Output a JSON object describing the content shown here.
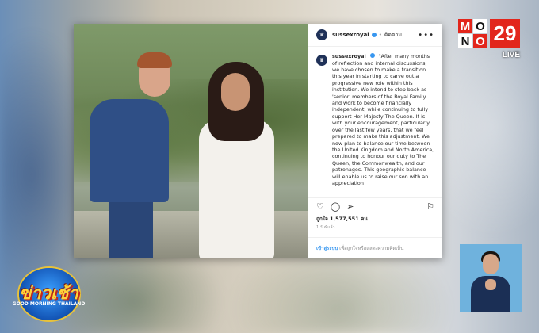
{
  "channel": {
    "logo_letters": [
      "M",
      "O",
      "N",
      "O"
    ],
    "logo_number": "29",
    "live_label": "LIVE"
  },
  "show": {
    "title": "ข่าวเช้า",
    "subtitle": "GOOD MORNING THAILAND"
  },
  "post": {
    "username": "sussexroyal",
    "follow_label": "ติดตาม",
    "more_label": "•••",
    "caption": "\"After many months of reflection and internal discussions, we have chosen to make a transition this year in starting to carve out a progressive new role within this institution. We intend to step back as 'senior' members of the Royal Family and work to become financially independent, while continuing to fully support Her Majesty The Queen. It is with your encouragement, particularly over the last few years, that we feel prepared to make this adjustment. We now plan to balance our time between the United Kingdom and North America, continuing to honour our duty to The Queen, the Commonwealth, and our patronages. This geographic balance will enable us to raise our son with an appreciation",
    "likes": "ถูกใจ 1,577,551 คน",
    "time": "1 วันที่แล้ว",
    "login_link": "เข้าสู่ระบบ",
    "login_text": "เพื่อถูกใจหรือแสดงความคิดเห็น"
  },
  "colors": {
    "accent_red": "#e2261c",
    "instagram_link": "#3897f0",
    "avatar_navy": "#1f3158"
  },
  "icons": [
    "heart-icon",
    "comment-icon",
    "share-icon",
    "bookmark-icon",
    "verified-icon"
  ]
}
